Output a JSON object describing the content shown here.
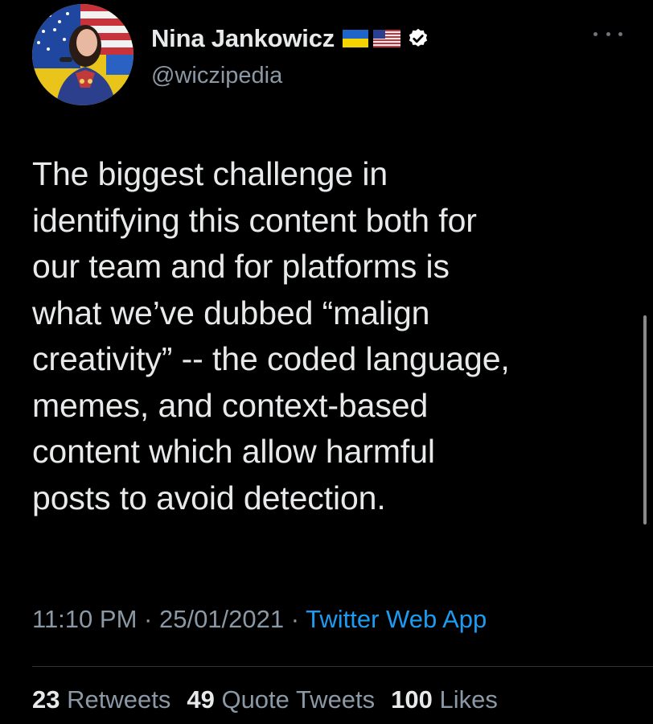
{
  "author": {
    "display_name": "Nina Jankowicz",
    "handle": "@wiczipedia",
    "flags": [
      "ukraine-flag",
      "us-flag"
    ],
    "verified": true
  },
  "tweet": {
    "lines": [
      "The biggest challenge in",
      "identifying this content both for",
      "our team and for platforms is",
      "what we’ve dubbed “malign",
      "creativity” -- the coded language,",
      "memes, and context-based",
      "content which allow harmful",
      "posts to avoid detection."
    ]
  },
  "meta": {
    "time": "11:10 PM",
    "separator": "·",
    "date": "25/01/2021",
    "source": "Twitter Web App"
  },
  "stats": {
    "retweets_count": "23",
    "retweets_label": "Retweets",
    "quotes_count": "49",
    "quotes_label": "Quote Tweets",
    "likes_count": "100",
    "likes_label": "Likes"
  },
  "colors": {
    "background": "#000000",
    "text": "#e7e9ea",
    "secondary": "#8b98a5",
    "link": "#1d9bf0",
    "verified_badge": "#ffffff"
  }
}
